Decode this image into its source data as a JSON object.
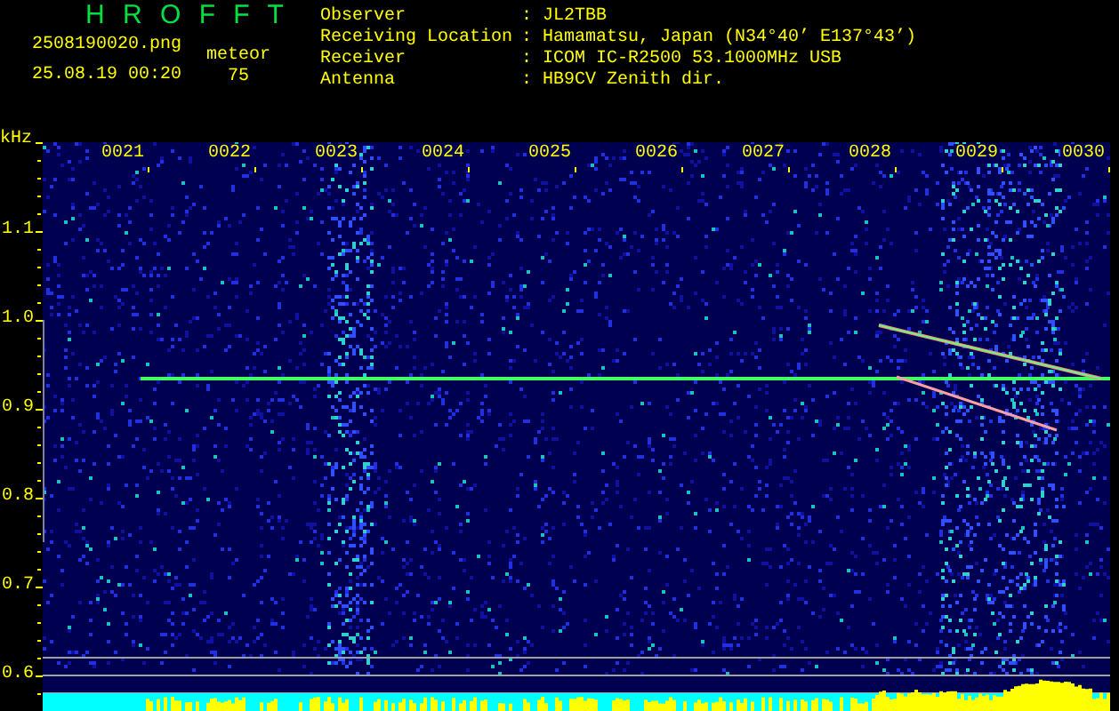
{
  "header": {
    "title": "H R O F F T",
    "filename": "2508190020.png",
    "timestamp": "25.08.19 00:20",
    "mode": "meteor",
    "count": "75"
  },
  "station": [
    {
      "label": "Observer",
      "separator": ":",
      "value": "JL2TBB"
    },
    {
      "label": "Receiving Location",
      "separator": ":",
      "value": "Hamamatsu, Japan (N34°40’ E137°43’)"
    },
    {
      "label": "Receiver",
      "separator": ":",
      "value": "ICOM IC-R2500 53.1000MHz USB"
    },
    {
      "label": "Antenna",
      "separator": ":",
      "value": "HB9CV Zenith dir."
    }
  ],
  "spectrogram": {
    "y_unit": "kHz",
    "y_labels": [
      "1.1",
      "1.0",
      "0.9",
      "0.8",
      "0.7",
      "0.6"
    ],
    "time_labels": [
      "0021",
      "0022",
      "0023",
      "0024",
      "0025",
      "0026",
      "0027",
      "0028",
      "0029",
      "0030"
    ]
  }
}
